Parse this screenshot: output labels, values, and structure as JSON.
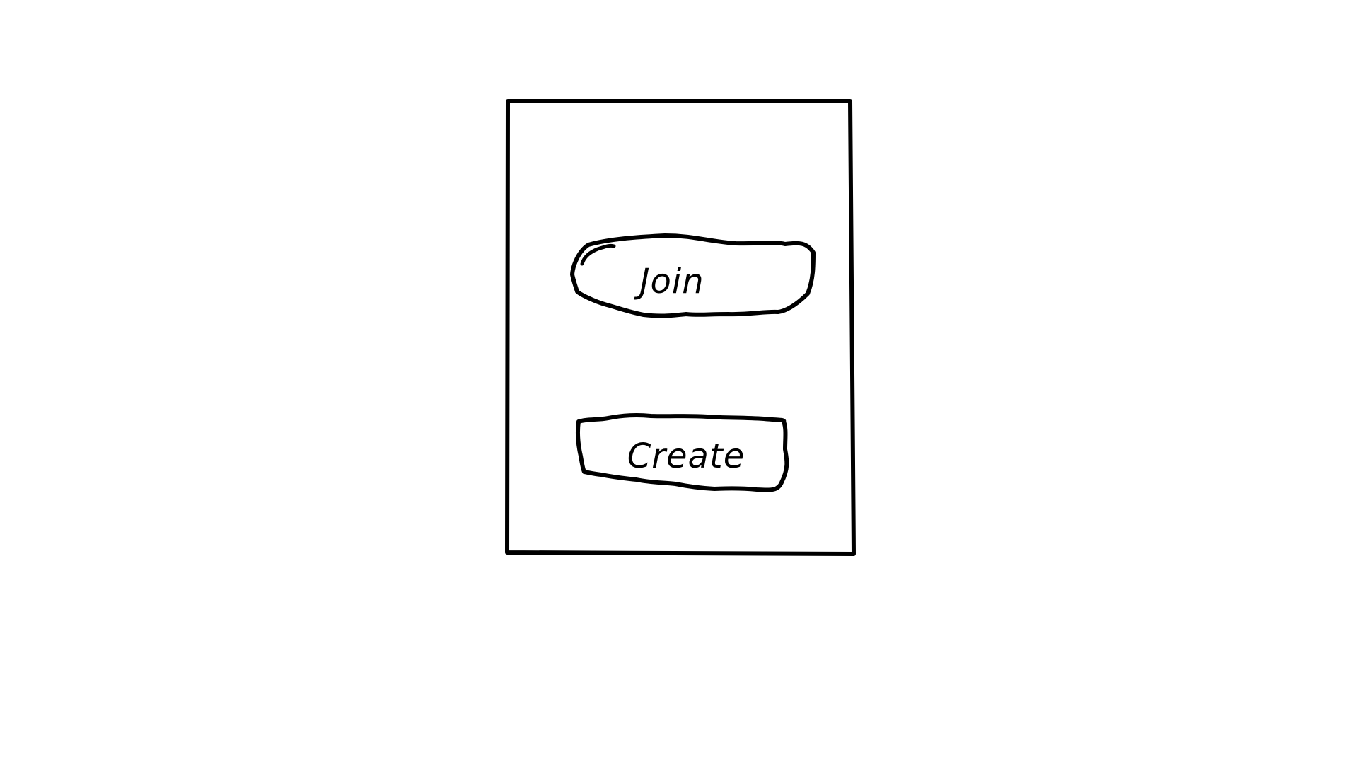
{
  "panel": {
    "join_label": "Join",
    "create_label": "Create"
  },
  "colors": {
    "stroke": "#000000",
    "background": "#ffffff"
  }
}
